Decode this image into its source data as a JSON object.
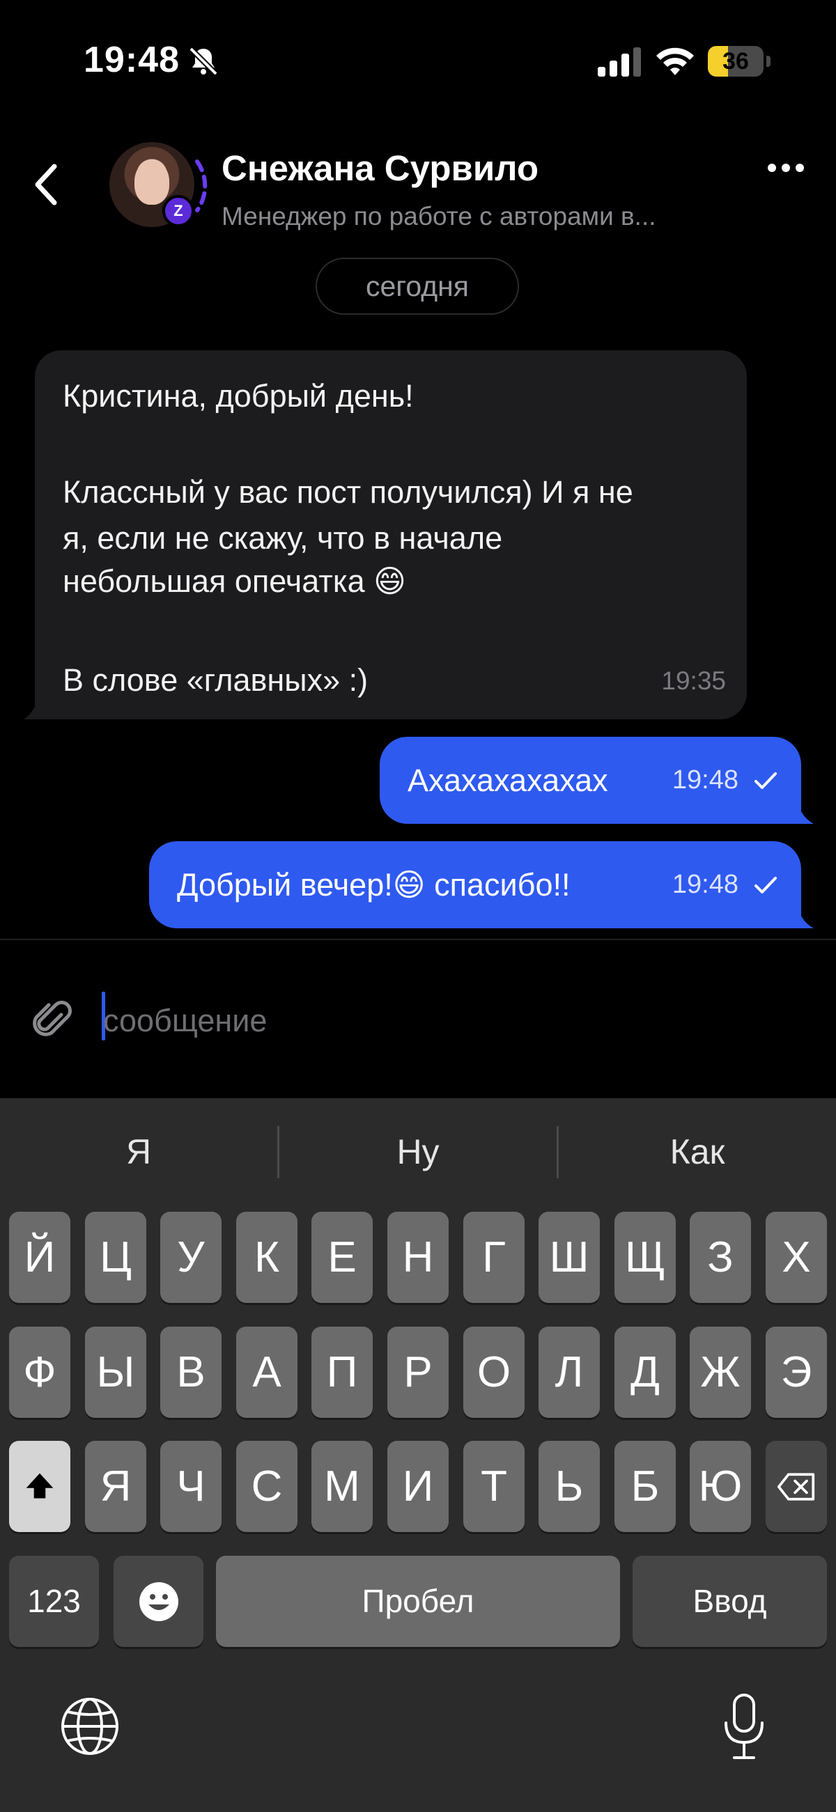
{
  "status_bar": {
    "time": "19:48",
    "battery_level": "36",
    "battery_fraction": 0.36
  },
  "header": {
    "contact_name": "Снежана Сурвило",
    "contact_subtitle": "Менеджер по работе с авторами в...",
    "avatar_badge": "Z"
  },
  "date_separator": "сегодня",
  "messages": {
    "incoming": {
      "line1": "Кристина, добрый день!",
      "line2": "Классный у вас пост получился) И я не",
      "line3": "я, если не скажу, что в начале",
      "line4": "небольшая опечатка 😄",
      "line5": "В слове «главных» :)",
      "time": "19:35"
    },
    "outgoing": [
      {
        "text": "Ахахахахахах",
        "time": "19:48"
      },
      {
        "text": "Добрый вечер!😄 спасибо!!",
        "time": "19:48"
      }
    ]
  },
  "composer": {
    "placeholder": "сообщение"
  },
  "keyboard": {
    "suggestions": [
      "Я",
      "Ну",
      "Как"
    ],
    "row1": [
      "Й",
      "Ц",
      "У",
      "К",
      "Е",
      "Н",
      "Г",
      "Ш",
      "Щ",
      "З",
      "Х"
    ],
    "row2": [
      "Ф",
      "Ы",
      "В",
      "А",
      "П",
      "Р",
      "О",
      "Л",
      "Д",
      "Ж",
      "Э"
    ],
    "row3": [
      "Я",
      "Ч",
      "С",
      "М",
      "И",
      "Т",
      "Ь",
      "Б",
      "Ю"
    ],
    "numbers_label": "123",
    "space_label": "Пробел",
    "return_label": "Ввод"
  }
}
